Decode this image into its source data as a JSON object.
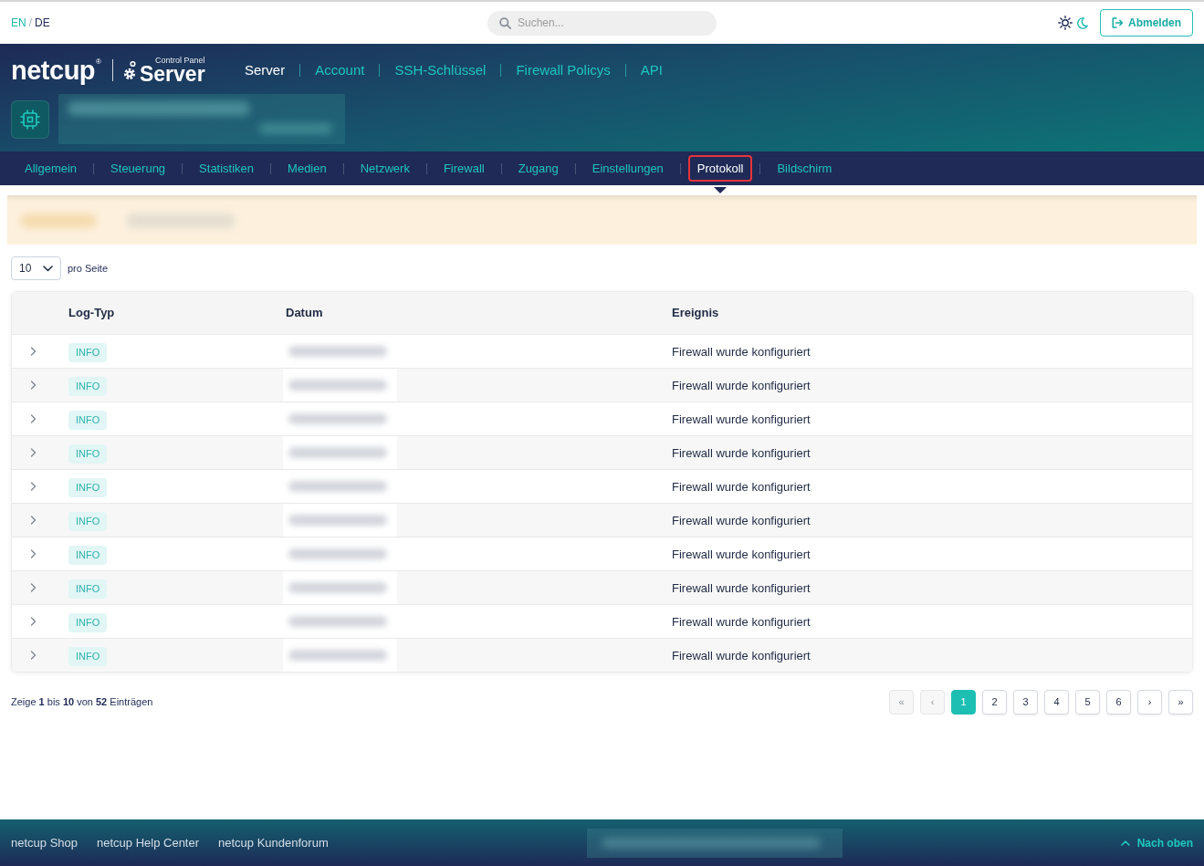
{
  "language_switch": [
    {
      "label": "EN",
      "selected": false
    },
    {
      "label": "DE",
      "selected": true
    }
  ],
  "language_separator": "/",
  "search": {
    "placeholder": "Suchen..."
  },
  "theme_switch": [
    {
      "kind": "light",
      "selected": true
    },
    {
      "kind": "dark",
      "selected": false
    }
  ],
  "logout_button": {
    "label": "Abmelden"
  },
  "brand": {
    "name": "netcup",
    "registered_mark": "®",
    "product_caption": "Control Panel",
    "product": "Server"
  },
  "main_nav": [
    {
      "label": "Server",
      "selected": true
    },
    {
      "label": "Account",
      "selected": false
    },
    {
      "label": "SSH-Schlüssel",
      "selected": false
    },
    {
      "label": "Firewall Policys",
      "selected": false
    },
    {
      "label": "API",
      "selected": false
    }
  ],
  "tabs": [
    {
      "label": "Allgemein",
      "selected": false
    },
    {
      "label": "Steuerung",
      "selected": false
    },
    {
      "label": "Statistiken",
      "selected": false
    },
    {
      "label": "Medien",
      "selected": false
    },
    {
      "label": "Netzwerk",
      "selected": false
    },
    {
      "label": "Firewall",
      "selected": false
    },
    {
      "label": "Zugang",
      "selected": false
    },
    {
      "label": "Einstellungen",
      "selected": false
    },
    {
      "label": "Protokoll",
      "selected": true
    },
    {
      "label": "Bildschirm",
      "selected": false
    }
  ],
  "per_page": {
    "value": "10",
    "label": "pro Seite"
  },
  "table": {
    "columns": [
      "Log-Typ",
      "Datum",
      "Ereignis"
    ],
    "rows": [
      {
        "expanded": false,
        "log_type": "INFO",
        "event": "Firewall wurde konfiguriert"
      },
      {
        "expanded": false,
        "log_type": "INFO",
        "event": "Firewall wurde konfiguriert"
      },
      {
        "expanded": false,
        "log_type": "INFO",
        "event": "Firewall wurde konfiguriert"
      },
      {
        "expanded": false,
        "log_type": "INFO",
        "event": "Firewall wurde konfiguriert"
      },
      {
        "expanded": false,
        "log_type": "INFO",
        "event": "Firewall wurde konfiguriert"
      },
      {
        "expanded": false,
        "log_type": "INFO",
        "event": "Firewall wurde konfiguriert"
      },
      {
        "expanded": false,
        "log_type": "INFO",
        "event": "Firewall wurde konfiguriert"
      },
      {
        "expanded": false,
        "log_type": "INFO",
        "event": "Firewall wurde konfiguriert"
      },
      {
        "expanded": false,
        "log_type": "INFO",
        "event": "Firewall wurde konfiguriert"
      },
      {
        "expanded": false,
        "log_type": "INFO",
        "event": "Firewall wurde konfiguriert"
      }
    ]
  },
  "summary": "Zeige **1** bis **10** von **52** Einträgen",
  "pagination": [
    {
      "label": "«",
      "disabled": true,
      "selected": false
    },
    {
      "label": "‹",
      "disabled": true,
      "selected": false
    },
    {
      "label": "1",
      "disabled": false,
      "selected": true
    },
    {
      "label": "2",
      "disabled": false,
      "selected": false
    },
    {
      "label": "3",
      "disabled": false,
      "selected": false
    },
    {
      "label": "4",
      "disabled": false,
      "selected": false
    },
    {
      "label": "5",
      "disabled": false,
      "selected": false
    },
    {
      "label": "6",
      "disabled": false,
      "selected": false
    },
    {
      "label": "›",
      "disabled": false,
      "selected": false
    },
    {
      "label": "»",
      "disabled": false,
      "selected": false
    }
  ],
  "footer": {
    "links": [
      "netcup Shop",
      "netcup Help Center",
      "netcup Kundenforum"
    ],
    "back_to_top": "Nach oben"
  }
}
